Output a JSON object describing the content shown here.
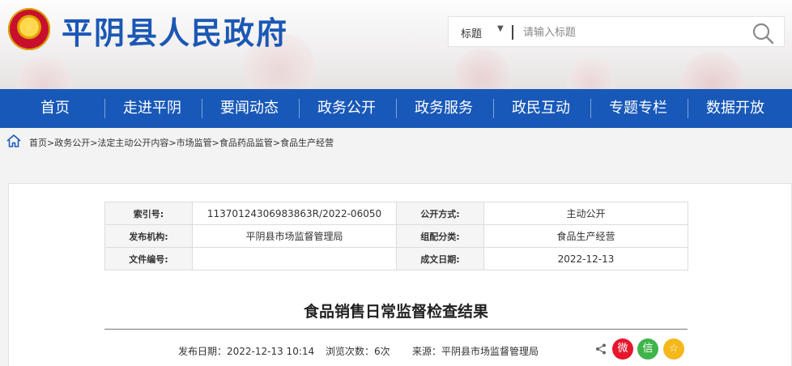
{
  "header": {
    "site_title": "平阴县人民政府",
    "emblem_glyph": "★",
    "search": {
      "category": "标题",
      "placeholder": "请输入标题",
      "caret": "▼"
    }
  },
  "nav": {
    "items": [
      "首页",
      "走进平阴",
      "要闻动态",
      "政务公开",
      "政务服务",
      "政民互动",
      "专题专栏",
      "数据开放"
    ]
  },
  "breadcrumb": {
    "items": [
      "首页",
      "政务公开",
      "法定主动公开内容",
      "市场监管",
      "食品药品监管",
      "食品生产经营"
    ],
    "separator": ">"
  },
  "meta": {
    "index_label": "索引号:",
    "index_value": "11370124306983863R/2022-06050",
    "open_mode_label": "公开方式:",
    "open_mode_value": "主动公开",
    "publisher_label": "发布机构:",
    "publisher_value": "平阴县市场监督管理局",
    "category_label": "组配分类:",
    "category_value": "食品生产经营",
    "doc_no_label": "文件编号:",
    "doc_no_value": "",
    "date_label": "成文日期:",
    "date_value": "2022-12-13"
  },
  "article": {
    "title": "食品销售日常监督检查结果",
    "publish_date": "发布日期：2022-12-13 10:14",
    "views": "浏览次数：6次",
    "source": "来源：平阴县市场监督管理局"
  },
  "share": {
    "weibo_glyph": "微",
    "wechat_glyph": "信",
    "favorite_glyph": "☆",
    "colors": {
      "weibo": "#e6162d",
      "wechat": "#3fb44a",
      "favorite": "#f5b81b"
    }
  },
  "colors": {
    "brand_blue": "#1858b8",
    "title_blue": "#1b58b5"
  }
}
